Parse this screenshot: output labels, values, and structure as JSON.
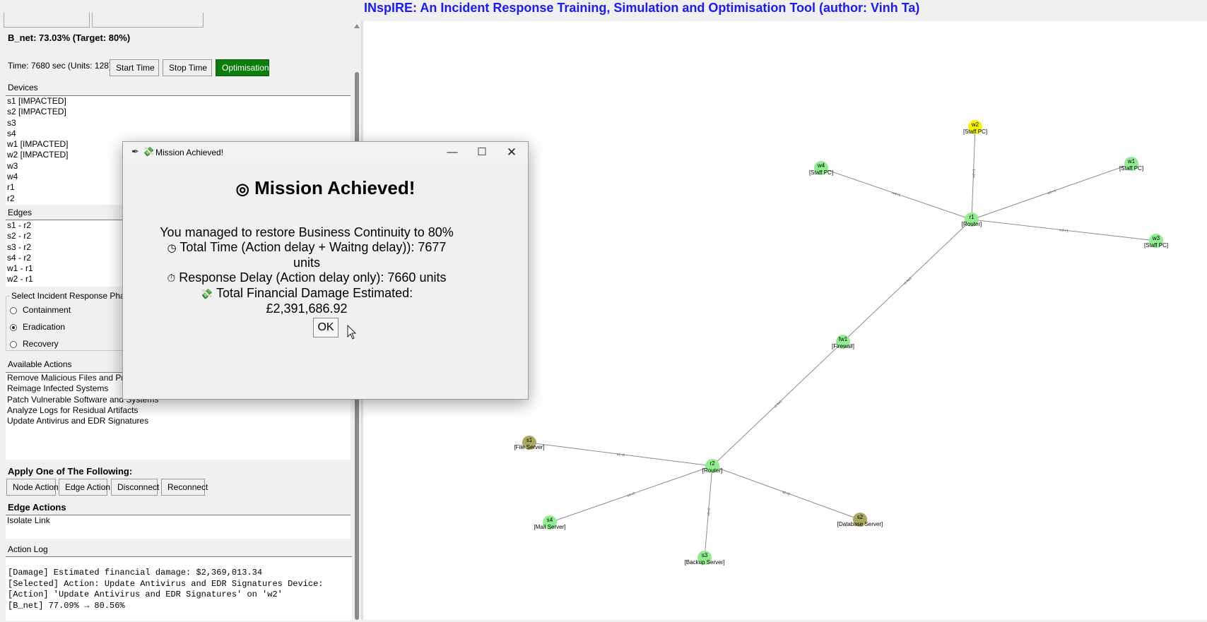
{
  "app": {
    "title": "INspIRE: An Incident Response Training, Simulation and Optimisation Tool (author: Vinh Ta)"
  },
  "status": {
    "bnet": "B_net: 73.03% (Target: 80%)",
    "time": "Time: 7680 sec (Units: 128)"
  },
  "controls": {
    "start": "Start Time",
    "stop": "Stop Time",
    "optimisation": "Optimisation"
  },
  "devices": {
    "label": "Devices",
    "items": [
      "s1 [IMPACTED]",
      "s2 [IMPACTED]",
      "s3",
      "s4",
      "w1 [IMPACTED]",
      "w2 [IMPACTED]",
      "w3",
      "w4",
      "r1",
      "r2"
    ]
  },
  "edges": {
    "label": "Edges",
    "items": [
      "s1 - r2",
      "s2 - r2",
      "s3 - r2",
      "s4 - r2",
      "w1 - r1",
      "w2 - r1"
    ]
  },
  "phase": {
    "label": "Select Incident Response Phase",
    "options": [
      "Containment",
      "Eradication",
      "Recovery"
    ],
    "selected": "Eradication"
  },
  "actions": {
    "label": "Available Actions",
    "items": [
      "Remove Malicious Files and Processes",
      "Reimage Infected Systems",
      "Patch Vulnerable Software and Systems",
      "Analyze Logs for Residual Artifacts",
      "Update Antivirus and EDR Signatures"
    ]
  },
  "apply": {
    "label": "Apply One of The Following:",
    "node_action": "Node Action",
    "edge_action": "Edge Action",
    "disconnect": "Disconnect",
    "reconnect": "Reconnect"
  },
  "edge_actions": {
    "label": "Edge Actions",
    "items": [
      "Isolate Link"
    ]
  },
  "log": {
    "label": "Action Log",
    "lines": [
      "[Damage] Estimated financial damage: $2,369,013.34",
      "[Selected] Action: Update Antivirus and EDR Signatures  Device:",
      "[Action] 'Update Antivirus and EDR Signatures' on 'w2'",
      "[B_net] 77.09% → 80.56%"
    ]
  },
  "dialog": {
    "window_title": "Mission Achieved!",
    "heading": "Mission Achieved!",
    "line1": "You managed to restore Business Continuity to 80%",
    "line2": "Total Time (Action delay + Waitng delay)): 7677 units",
    "line3": "Response Delay (Action delay only): 7660 units",
    "line4": "Total Financial Damage Estimated: £2,391,686.92",
    "ok": "OK",
    "icon_heading": "target-icon",
    "icon_time": "clock-icon",
    "icon_delay": "stopwatch-icon",
    "icon_damage": "money-icon"
  },
  "graph": {
    "nodes": [
      {
        "id": "w2",
        "label": "w2",
        "sub": "[Staff PC]",
        "color": "#f5f500"
      },
      {
        "id": "w4",
        "label": "w4",
        "sub": "[Staff PC]",
        "color": "#90ee90"
      },
      {
        "id": "w1",
        "label": "w1",
        "sub": "[Staff PC]",
        "color": "#90ee90"
      },
      {
        "id": "r1",
        "label": "r1",
        "sub": "[Router]",
        "color": "#90ee90"
      },
      {
        "id": "w3",
        "label": "w3",
        "sub": "[Staff PC]",
        "color": "#90ee90"
      },
      {
        "id": "fw1",
        "label": "fw1",
        "sub": "[Firewall]",
        "color": "#90ee90"
      },
      {
        "id": "s1",
        "label": "s1",
        "sub": "[File Server]",
        "color": "#a8a860"
      },
      {
        "id": "r2",
        "label": "r2",
        "sub": "[Router]",
        "color": "#90ee90"
      },
      {
        "id": "s4",
        "label": "s4",
        "sub": "[Mail Server]",
        "color": "#90ee90"
      },
      {
        "id": "s2",
        "label": "s2",
        "sub": "[Database Server]",
        "color": "#a8a860"
      },
      {
        "id": "s3",
        "label": "s3",
        "sub": "[Backup Server]",
        "color": "#90ee90"
      }
    ],
    "edges": [
      {
        "from": "w2",
        "to": "r1",
        "label": "w2-r1"
      },
      {
        "from": "w4",
        "to": "r1",
        "label": "w4-r1"
      },
      {
        "from": "w1",
        "to": "r1",
        "label": "w1-r1"
      },
      {
        "from": "w3",
        "to": "r1",
        "label": "w3-r1"
      },
      {
        "from": "r1",
        "to": "fw1",
        "label": "r1-fw1"
      },
      {
        "from": "fw1",
        "to": "r2",
        "label": "r2-fw1"
      },
      {
        "from": "s1",
        "to": "r2",
        "label": "s1-r2"
      },
      {
        "from": "s4",
        "to": "r2",
        "label": "s4-r2"
      },
      {
        "from": "s2",
        "to": "r2",
        "label": "s2-r2"
      },
      {
        "from": "s3",
        "to": "r2",
        "label": "s3-r2"
      }
    ]
  }
}
